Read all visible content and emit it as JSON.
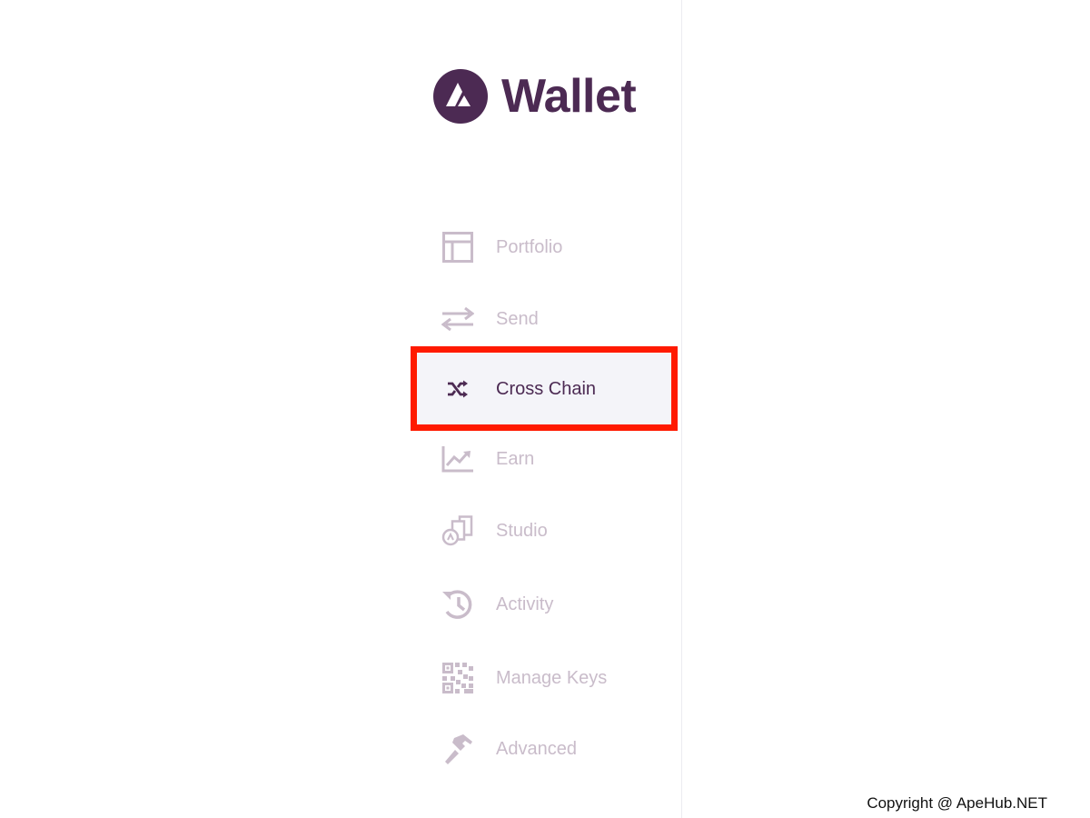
{
  "app": {
    "logo_text": "Wallet"
  },
  "nav": {
    "items": [
      {
        "label": "Portfolio",
        "icon": "portfolio-icon"
      },
      {
        "label": "Send",
        "icon": "send-arrows-icon"
      },
      {
        "label": "Cross Chain",
        "icon": "shuffle-icon",
        "active": true
      },
      {
        "label": "Earn",
        "icon": "chart-icon"
      },
      {
        "label": "Studio",
        "icon": "studio-icon"
      },
      {
        "label": "Activity",
        "icon": "history-icon"
      },
      {
        "label": "Manage Keys",
        "icon": "qr-code-icon"
      },
      {
        "label": "Advanced",
        "icon": "hammer-icon"
      }
    ]
  },
  "footer": {
    "copyright": "Copyright @ ApeHub.NET"
  },
  "colors": {
    "brand": "#4c2a53",
    "inactive_text": "#c9bcca",
    "active_bg": "#f4f4f9",
    "highlight": "#ff1a00"
  }
}
